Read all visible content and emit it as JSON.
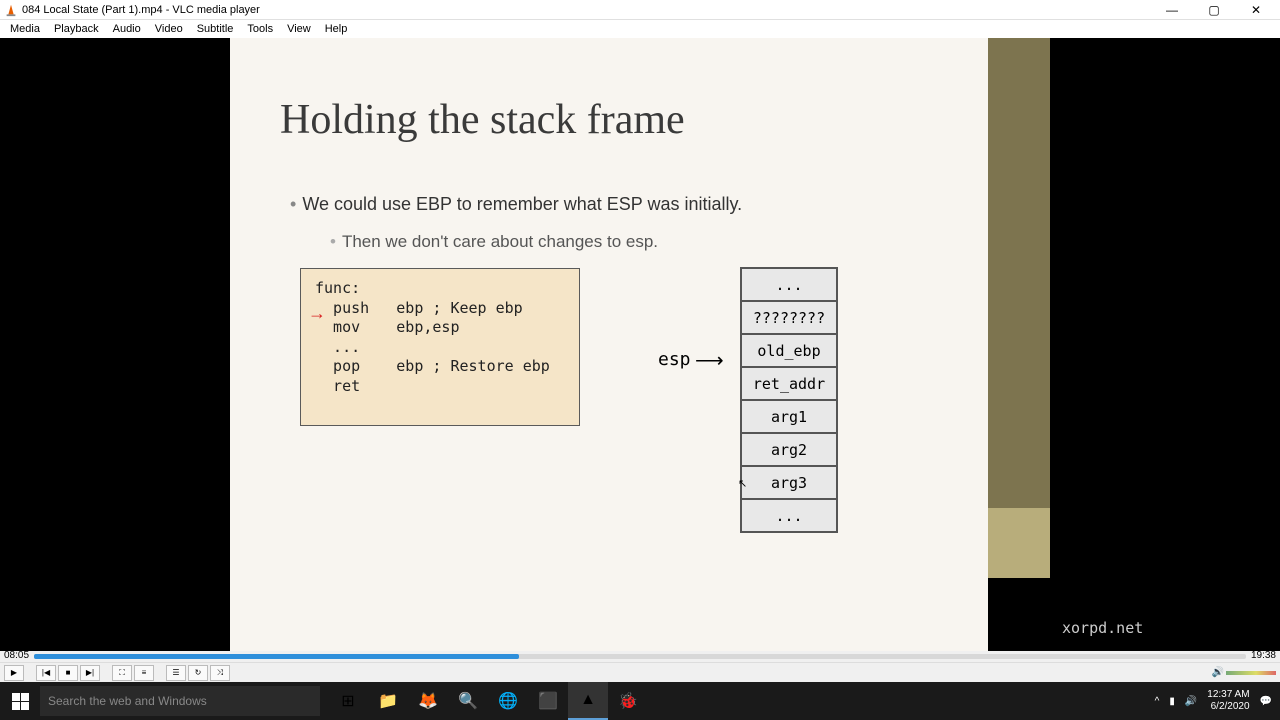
{
  "window": {
    "title": "084 Local State (Part 1).mp4 - VLC media player"
  },
  "menu": {
    "items": [
      "Media",
      "Playback",
      "Audio",
      "Video",
      "Subtitle",
      "Tools",
      "View",
      "Help"
    ]
  },
  "slide": {
    "title": "Holding the stack frame",
    "bullet1": "We could use EBP to remember what ESP was initially.",
    "bullet2": "Then we don't care about changes to esp.",
    "code": {
      "line1": "func:",
      "line2": "  push   ebp ; Keep ebp",
      "line3": "  mov    ebp,esp",
      "line4": "",
      "line5": "  ...",
      "line6": "",
      "line7": "  pop    ebp ; Restore ebp",
      "line8": "  ret"
    },
    "stack_label": "esp",
    "stack": [
      "...",
      "????????",
      "old_ebp",
      "ret_addr",
      "arg1",
      "arg2",
      "arg3",
      "..."
    ],
    "watermark": "xorpd.net"
  },
  "playback": {
    "current": "08:05",
    "total": "19:38",
    "progress_pct": 40
  },
  "system": {
    "search_placeholder": "Search the web and Windows",
    "time": "12:37 AM",
    "date": "6/2/2020"
  }
}
